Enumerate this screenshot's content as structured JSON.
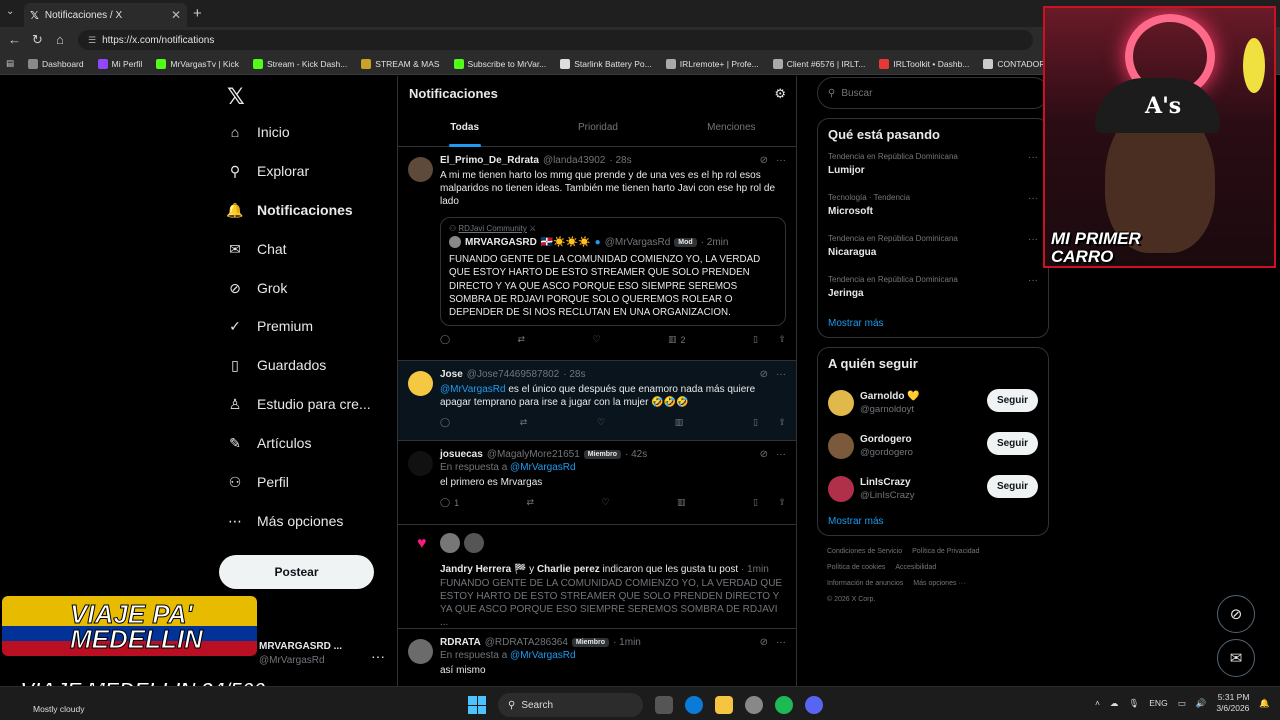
{
  "browser": {
    "tab_title": "Notificaciones / X",
    "url": "https://x.com/notifications",
    "bookmarks": [
      {
        "label": "Dashboard",
        "color": "#8a8a8a"
      },
      {
        "label": "Mi Perfil",
        "color": "#9146ff"
      },
      {
        "label": "MrVargasTv | Kick",
        "color": "#53fc18"
      },
      {
        "label": "Stream - Kick Dash...",
        "color": "#53fc18"
      },
      {
        "label": "STREAM & MAS",
        "color": "#c9a227"
      },
      {
        "label": "Subscribe to MrVar...",
        "color": "#53fc18"
      },
      {
        "label": "Starlink Battery Po...",
        "color": "#dddddd"
      },
      {
        "label": "IRLremote+ | Profe...",
        "color": "#aaaaaa"
      },
      {
        "label": "Client #6576 | IRLT...",
        "color": "#aaaaaa"
      },
      {
        "label": "IRLToolkit • Dashb...",
        "color": "#e53935"
      },
      {
        "label": "CONTADOR",
        "color": "#cccccc"
      }
    ]
  },
  "nav": {
    "items": [
      {
        "label": "Inicio",
        "icon": "home-icon",
        "glyph": "⌂"
      },
      {
        "label": "Explorar",
        "icon": "search-icon",
        "glyph": "⚲"
      },
      {
        "label": "Notificaciones",
        "icon": "bell-icon",
        "glyph": "🔔"
      },
      {
        "label": "Chat",
        "icon": "mail-icon",
        "glyph": "✉"
      },
      {
        "label": "Grok",
        "icon": "grok-icon",
        "glyph": "⊘"
      },
      {
        "label": "Premium",
        "icon": "verified-icon",
        "glyph": "✓"
      },
      {
        "label": "Guardados",
        "icon": "bookmark-icon",
        "glyph": "▯"
      },
      {
        "label": "Estudio para cre...",
        "icon": "studio-icon",
        "glyph": "♙"
      },
      {
        "label": "Artículos",
        "icon": "article-icon",
        "glyph": "✎"
      },
      {
        "label": "Perfil",
        "icon": "person-icon",
        "glyph": "⚇"
      },
      {
        "label": "Más opciones",
        "icon": "more-circle-icon",
        "glyph": "⋯"
      }
    ],
    "post_button": "Postear",
    "profile_name": "MRVARGASRD ...",
    "profile_handle": "@MrVargasRd"
  },
  "center": {
    "title": "Notificaciones",
    "tabs": [
      "Todas",
      "Prioridad",
      "Menciones"
    ]
  },
  "posts": {
    "p1": {
      "name": "El_Primo_De_Rdrata",
      "handle": "@landa43902",
      "time": "· 28s",
      "body": "A mi me tienen harto los mmg que prende y de una ves es el hp rol esos malparidos no tienen ideas. También me tienen harto Javi con ese hp rol de lado",
      "quote_community": "RDJavi Community",
      "quote_name": "MRVARGASRD",
      "quote_emoji": "🇩🇴☀️☀️☀️",
      "quote_handle": "@MrVargasRd",
      "quote_badge": "Mod",
      "quote_time": "· 2min",
      "quote_body": "FUNANDO GENTE DE LA COMUNIDAD COMIENZO YO, LA VERDAD QUE ESTOY HARTO DE ESTO STREAMER QUE SOLO PRENDEN DIRECTO Y YA QUE ASCO PORQUE ESO SIEMPRE SEREMOS SOMBRA DE RDJAVI PORQUE SOLO QUEREMOS ROLEAR O DEPENDER DE SI NOS RECLUTAN EN UNA ORGANIZACION.",
      "views": "2"
    },
    "p2": {
      "name": "Jose",
      "handle": "@Jose74469587802",
      "time": "· 28s",
      "mention": "@MrVargasRd",
      "body": "es el único que después que enamoro nada más quiere apagar temprano para irse a jugar con la mujer 🤣🤣🤣"
    },
    "p3": {
      "name": "josuecas",
      "handle": "@MagalyMore21651",
      "badge": "Miembro",
      "time": "· 42s",
      "reply_prefix": "En respuesta a",
      "reply_to": "@MrVargasRd",
      "body": "el primero es Mrvargas",
      "replies": "1"
    },
    "like": {
      "who1": "Jandry Herrera",
      "who1_emoji": "🏁",
      "connector": "y",
      "who2": "Charlie perez",
      "action": "indicaron que les gusta tu post",
      "time": "· 1min",
      "quote": "FUNANDO GENTE DE LA COMUNIDAD COMIENZO YO, LA VERDAD QUE ESTOY HARTO DE ESTO STREAMER QUE SOLO PRENDEN DIRECTO Y YA QUE ASCO PORQUE ESO SIEMPRE SEREMOS SOMBRA DE RDJAVI ..."
    },
    "p4": {
      "name": "RDRATA",
      "handle": "@RDRATA286364",
      "badge": "Miembro",
      "time": "· 1min",
      "reply_prefix": "En respuesta a",
      "reply_to": "@MrVargasRd",
      "body": "así mismo"
    }
  },
  "right": {
    "search_placeholder": "Buscar",
    "trends_title": "Qué está pasando",
    "trends": [
      {
        "context": "Tendencia en República Dominicana",
        "topic": "Lumijor"
      },
      {
        "context": "Tecnología · Tendencia",
        "topic": "Microsoft"
      },
      {
        "context": "Tendencia en República Dominicana",
        "topic": "Nicaragua"
      },
      {
        "context": "Tendencia en República Dominicana",
        "topic": "Jeringa"
      }
    ],
    "show_more": "Mostrar más",
    "follow_title": "A quién seguir",
    "follows": [
      {
        "name": "Garnoldo 💛",
        "handle": "@garnoldoyt",
        "button": "Seguir",
        "color": "#e0b94a"
      },
      {
        "name": "Gordogero",
        "handle": "@gordogero",
        "button": "Seguir",
        "color": "#7a5a3a"
      },
      {
        "name": "LinIsCrazy",
        "handle": "@LinIsCrazy",
        "button": "Seguir",
        "color": "#b0304a"
      }
    ],
    "follow_more": "Mostrar más",
    "legal": [
      "Condiciones de Servicio",
      "Política de Privacidad",
      "Política de cookies",
      "Accesibilidad",
      "Información de anuncios",
      "Más opciones ···",
      "© 2026 X Corp."
    ]
  },
  "stream": {
    "webcam_caption_line1": "MI PRIMER",
    "webcam_caption_line2": "CARRO",
    "overlay_line1": "VIAJE PA'",
    "overlay_line2": "MEDELLIN",
    "counter": "VIAJE MEDELLIN 24/500"
  },
  "taskbar": {
    "weather": "Mostly cloudy",
    "search": "Search",
    "lang": "ENG",
    "time": "5:31 PM",
    "date": "3/6/2026"
  }
}
